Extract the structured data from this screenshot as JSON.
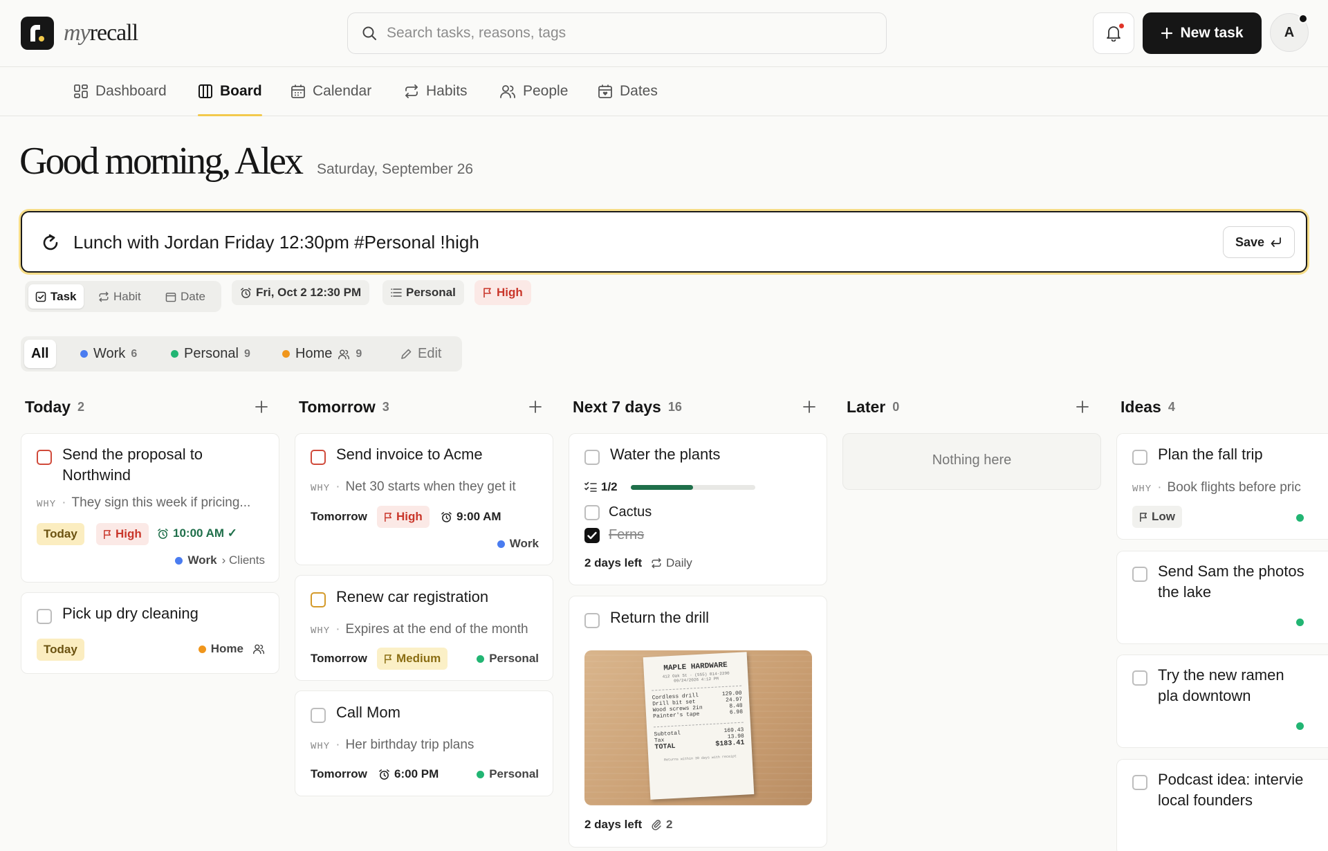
{
  "app": {
    "brand_prefix": "my",
    "brand_suffix": "recall"
  },
  "search": {
    "placeholder": "Search tasks, reasons, tags"
  },
  "header": {
    "new_task_label": "New task",
    "avatar_initial": "A"
  },
  "nav": {
    "items": [
      {
        "label": "Dashboard",
        "icon": "dashboard-icon"
      },
      {
        "label": "Board",
        "icon": "board-icon",
        "active": true
      },
      {
        "label": "Calendar",
        "icon": "calendar-icon"
      },
      {
        "label": "Habits",
        "icon": "repeat-icon"
      },
      {
        "label": "People",
        "icon": "people-icon"
      },
      {
        "label": "Dates",
        "icon": "dates-icon"
      }
    ]
  },
  "greeting": {
    "title": "Good morning, Alex",
    "date": "Saturday, September 26"
  },
  "quick_add": {
    "text": "Lunch with Jordan Friday 12:30pm #Personal !high",
    "save_label": "Save",
    "types": [
      "Task",
      "Habit",
      "Date"
    ],
    "active_type": "Task",
    "parsed": {
      "datetime": "Fri, Oct 2 12:30 PM",
      "list": "Personal",
      "priority": "High"
    }
  },
  "filters": {
    "all_label": "All",
    "lists": [
      {
        "name": "Work",
        "count": "6",
        "color": "#4a7cf0"
      },
      {
        "name": "Personal",
        "count": "9",
        "color": "#22b573"
      },
      {
        "name": "Home",
        "count": "9",
        "color": "#f0961c"
      }
    ],
    "edit_label": "Edit"
  },
  "colors": {
    "work": "#4a7cf0",
    "personal": "#22b573",
    "home": "#f0961c",
    "accent": "#f2c94c",
    "high": "#c9362a",
    "progress": "#1f6f4a"
  },
  "columns": [
    {
      "title": "Today",
      "count": "2"
    },
    {
      "title": "Tomorrow",
      "count": "3"
    },
    {
      "title": "Next 7 days",
      "count": "16"
    },
    {
      "title": "Later",
      "count": "0",
      "empty_text": "Nothing here"
    },
    {
      "title": "Ideas",
      "count": "4"
    }
  ],
  "cards": {
    "proposal": {
      "title": "Send the proposal to Northwind",
      "why_label": "WHY",
      "why": "They sign this week if pricing...",
      "due": "Today",
      "priority": "High",
      "time": "10:00 AM ✓",
      "list": "Work",
      "sublist": "› Clients"
    },
    "drycleaning": {
      "title": "Pick up dry cleaning",
      "due": "Today",
      "list": "Home"
    },
    "invoice": {
      "title": "Send invoice to Acme",
      "why_label": "WHY",
      "why": "Net 30 starts when they get it",
      "due": "Tomorrow",
      "priority": "High",
      "time": "9:00 AM",
      "list": "Work"
    },
    "car": {
      "title": "Renew car registration",
      "why_label": "WHY",
      "why": "Expires at the end of the month",
      "due": "Tomorrow",
      "priority": "Medium",
      "list": "Personal"
    },
    "mom": {
      "title": "Call Mom",
      "why_label": "WHY",
      "why": "Her birthday trip plans",
      "due": "Tomorrow",
      "time": "6:00 PM",
      "list": "Personal"
    },
    "plants": {
      "title": "Water the plants",
      "progress_label": "1/2",
      "progress": 0.5,
      "subtasks": [
        {
          "label": "Cactus",
          "done": false
        },
        {
          "label": "Ferns",
          "done": true
        }
      ],
      "due": "2 days left",
      "repeat": "Daily"
    },
    "drill": {
      "title": "Return the drill",
      "due": "2 days left",
      "attachments": "2",
      "receipt": {
        "store": "MAPLE HARDWARE",
        "address": "412 Oak St · (555) 014-2290",
        "stamp": "09/24/2026 4:12 PM",
        "lines": [
          {
            "item": "Cordless drill",
            "price": "129.00"
          },
          {
            "item": "Drill bit set",
            "price": "24.97"
          },
          {
            "item": "Wood screws 2in",
            "price": "8.48"
          },
          {
            "item": "Painter's tape",
            "price": "6.98"
          }
        ],
        "subtotal_label": "Subtotal",
        "subtotal": "169.43",
        "tax_label": "Tax",
        "tax": "13.98",
        "total_label": "TOTAL",
        "total": "$183.41",
        "footer": "Returns within 30 days with receipt"
      }
    },
    "trip": {
      "title": "Plan the fall trip",
      "why_label": "WHY",
      "why": "Book flights before pric",
      "priority": "Low"
    },
    "sam": {
      "title": "Send Sam the photos the lake"
    },
    "ramen": {
      "title": "Try the new ramen pla downtown"
    },
    "podcast": {
      "title": "Podcast idea: intervie local founders"
    }
  }
}
